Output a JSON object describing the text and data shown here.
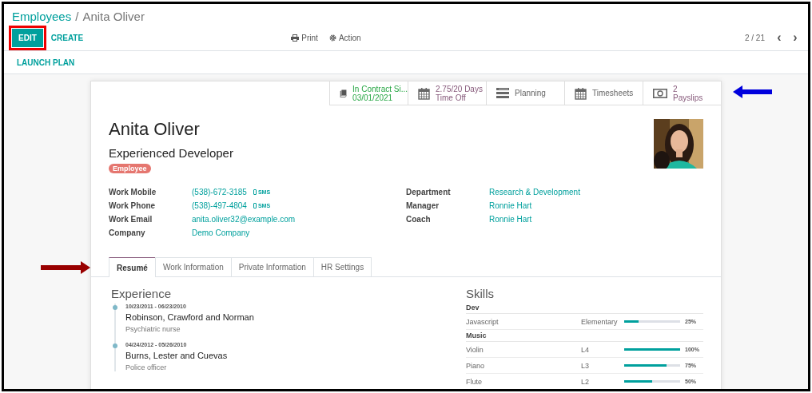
{
  "breadcrumb": {
    "parent": "Employees",
    "separator": "/",
    "current": "Anita Oliver"
  },
  "toolbar": {
    "edit": {
      "label": "EDIT",
      "highlighted": true
    },
    "create": "CREATE",
    "print": "Print",
    "action": "Action",
    "pager": "2 / 21",
    "prev": "‹",
    "next": "›"
  },
  "launch_plan": "LAUNCH PLAN",
  "stat_buttons": [
    {
      "kind": "contract",
      "line1": "In Contract Si...",
      "line2": "03/01/2021"
    },
    {
      "kind": "timeoff",
      "line1": "2.75/20 Days",
      "line2": "Time Off"
    },
    {
      "kind": "planning",
      "line1": "Planning"
    },
    {
      "kind": "timesheets",
      "line1": "Timesheets"
    },
    {
      "kind": "payslips",
      "line1": "2",
      "line2": "Payslips"
    }
  ],
  "employee": {
    "name": "Anita Oliver",
    "job_title": "Experienced Developer",
    "tag": "Employee"
  },
  "fields_left": [
    {
      "label": "Work Mobile",
      "value": "(538)-672-3185",
      "sms": "SMS"
    },
    {
      "label": "Work Phone",
      "value": "(538)-497-4804",
      "sms": "SMS"
    },
    {
      "label": "Work Email",
      "value": "anita.oliver32@example.com"
    },
    {
      "label": "Company",
      "value": "Demo Company"
    }
  ],
  "fields_right": [
    {
      "label": "Department",
      "value": "Research & Development"
    },
    {
      "label": "Manager",
      "value": "Ronnie Hart"
    },
    {
      "label": "Coach",
      "value": "Ronnie Hart"
    }
  ],
  "tabs": [
    {
      "label": "Resumé",
      "selected": true
    },
    {
      "label": "Work Information",
      "selected": false
    },
    {
      "label": "Private Information",
      "selected": false
    },
    {
      "label": "HR Settings",
      "selected": false
    }
  ],
  "experience": {
    "title": "Experience",
    "entries": [
      {
        "dates": "10/23/2011 - 06/23/2010",
        "company": "Robinson, Crawford and Norman",
        "role": "Psychiatric nurse"
      },
      {
        "dates": "04/24/2012 - 05/26/2010",
        "company": "Burns, Lester and Cuevas",
        "role": "Police officer"
      }
    ]
  },
  "skills": {
    "title": "Skills",
    "groups": [
      {
        "name": "Dev",
        "items": [
          {
            "name": "Javascript",
            "level_name": "Elementary",
            "level": 0.25,
            "percent": "25%"
          }
        ]
      },
      {
        "name": "Music",
        "items": [
          {
            "name": "Violin",
            "level_name": "L4",
            "level": 1,
            "percent": "100%"
          },
          {
            "name": "Piano",
            "level_name": "L3",
            "level": 0.75,
            "percent": "75%"
          },
          {
            "name": "Flute",
            "level_name": "L2",
            "level": 0.5,
            "percent": "50%"
          }
        ]
      }
    ]
  },
  "annotations": [
    {
      "kind": "left-arrow",
      "color": "#0000dd"
    },
    {
      "kind": "right-arrow",
      "color": "#990000"
    }
  ]
}
